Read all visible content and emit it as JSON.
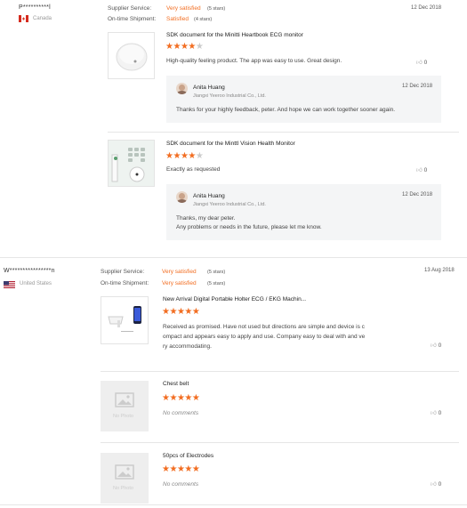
{
  "reviews": [
    {
      "user": "P**********l",
      "country": "Canada",
      "flag": "ca",
      "supplier_label": "Supplier Service:",
      "supplier_value": "Very satisfied",
      "supplier_stars": "(5 stars)",
      "shipment_label": "On-time Shipment:",
      "shipment_value": "Satisfied",
      "shipment_stars": "(4 stars)",
      "date": "12 Dec 2018",
      "items": [
        {
          "title": "SDK document for the Minitti Heartbook ECG monitor",
          "rating": 4,
          "text": "High-quality feeling product.  The app was easy to use. Great design.",
          "likes": "0",
          "reply": {
            "name": "Anita Huang",
            "company": "Jiangxi Yeeroo Industrial Co., Ltd.",
            "date": "12 Dec 2018",
            "text_lines": [
              "Thanks for your highly feedback, peter. And hope we can work together sooner again."
            ]
          }
        },
        {
          "title": "SDK document for the Minttl Vision Health Monitor",
          "rating": 4,
          "text": "Exactly as requested",
          "likes": "0",
          "reply": {
            "name": "Anita Huang",
            "company": "Jiangxi Yeeroo Industrial Co., Ltd.",
            "date": "12 Dec 2018",
            "text_lines": [
              "Thanks, my dear peter.",
              "Any problems or needs in the future, please let me know."
            ]
          }
        }
      ]
    },
    {
      "user": "W****************n",
      "country": "United States",
      "flag": "us",
      "supplier_label": "Supplier Service:",
      "supplier_value": "Very satisfied",
      "supplier_stars": "(5 stars)",
      "shipment_label": "On-time Shipment:",
      "shipment_value": "Very satisfied",
      "shipment_stars": "(5 stars)",
      "date": "13 Aug 2018",
      "items": [
        {
          "title": "New Arrival Digital Portable Holter ECG / EKG Machin...",
          "rating": 5,
          "text_lines": [
            "Received as promised.  Have not used but directions are simple and device is c",
            "ompact and appears easy to apply and use.  Company easy to deal with and ve",
            "ry accommodating."
          ],
          "likes": "0"
        },
        {
          "title": "Chest belt",
          "rating": 5,
          "text": "No comments",
          "no_photo": "No Photo",
          "likes": "0"
        },
        {
          "title": "50pcs of Electrodes",
          "rating": 5,
          "text": "No comments",
          "no_photo": "No Photo",
          "likes": "0"
        }
      ]
    }
  ],
  "colors": {
    "accent": "#f26d21",
    "star_off": "#cccccc",
    "reply_bg": "#f4f5f6"
  },
  "icons": {
    "like": "thumbs-up-icon",
    "star": "star-icon"
  }
}
